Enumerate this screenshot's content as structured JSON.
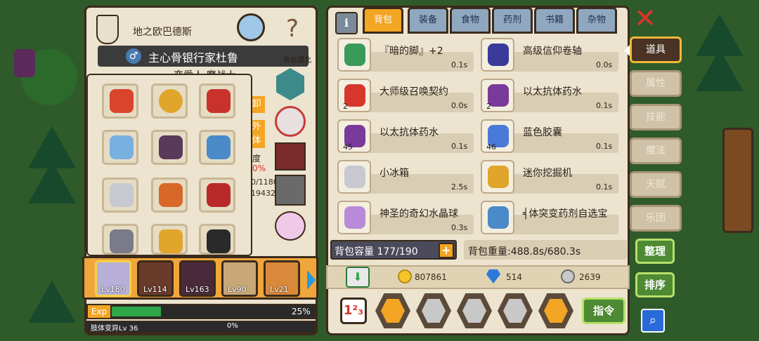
{
  "character": {
    "title": "地之欧巴德斯",
    "name": "主心骨银行家杜鲁",
    "origin": "来自湖北",
    "subtitle_partial": "恋爱人 魔战士",
    "side_partial": [
      "卸",
      "外",
      "体",
      "度",
      "0%",
      "0/1180",
      "19432"
    ]
  },
  "equipment_slots": [
    "devil-mask-icon",
    "ring-icon",
    "crown-icon",
    "feather-icon",
    "backpack-icon",
    "wing-gem-icon",
    "pickaxe-icon",
    "flame-sword-icon",
    "armor-icon",
    "wolf-helmet-icon",
    "bracelet-icon",
    "emerald-amulet-icon"
  ],
  "side_items": [
    "crystal-shield-icon",
    "flower-icon",
    "belt-icon",
    "mech-icon",
    "bunny-icon"
  ],
  "party": [
    {
      "level": "Lv180"
    },
    {
      "level": "Lv114"
    },
    {
      "level": "Lv163"
    },
    {
      "level": "Lv90"
    },
    {
      "level": "Lv21"
    }
  ],
  "exp": {
    "label": "Exp",
    "percent_text": "25%",
    "fill": 0.25
  },
  "variation": {
    "label": "肢体变异Lv 36",
    "percent_text": "0%",
    "fill": 0
  },
  "tabs": [
    "背包",
    "装备",
    "食物",
    "药剂",
    "书籍",
    "杂物"
  ],
  "active_tab": 0,
  "info_icon": "i",
  "items": [
    {
      "name": "『暗的脚』+2",
      "time": "0.1s",
      "count": "",
      "icon": "emerald-ring-icon"
    },
    {
      "name": "高级信仰卷轴",
      "time": "0.0s",
      "count": "",
      "icon": "scroll-icon"
    },
    {
      "name": "大师级召唤契约",
      "time": "0.0s",
      "count": "2",
      "icon": "contract-icon"
    },
    {
      "name": "以太抗体药水",
      "time": "0.1s",
      "count": "2",
      "icon": "potion-icon"
    },
    {
      "name": "以太抗体药水",
      "time": "0.1s",
      "count": "45",
      "icon": "potion-icon"
    },
    {
      "name": "蓝色胶囊",
      "time": "0.1s",
      "count": "46",
      "icon": "capsule-icon"
    },
    {
      "name": "小冰箱",
      "time": "2.5s",
      "count": "",
      "icon": "fridge-icon"
    },
    {
      "name": "迷你挖掘机",
      "time": "0.1s",
      "count": "",
      "icon": "excavator-icon"
    },
    {
      "name": "神圣的奇幻水晶球",
      "time": "0.3s",
      "count": "",
      "icon": "crystal-ball-icon"
    },
    {
      "name": "╡体突变药剂自选宝",
      "time": "",
      "count": "",
      "icon": "chest-icon"
    }
  ],
  "capacity": "背包容量 177/190",
  "weight": "背包重量:488.8s/680.3s",
  "currency": {
    "gold": "807861",
    "diamond": "514",
    "silver": "2639"
  },
  "side_tabs": [
    "道具",
    "属性",
    "技能",
    "魔法",
    "天赋",
    "乐团"
  ],
  "active_side_tab": 0,
  "buttons": {
    "command": "指令",
    "organize": "整理",
    "sort": "排序"
  },
  "colors": {
    "accent": "#f3a524",
    "frame": "#3b2a1c",
    "panel": "#ece4cf",
    "exp_green": "#2fa84a",
    "close": "#d8362b"
  }
}
